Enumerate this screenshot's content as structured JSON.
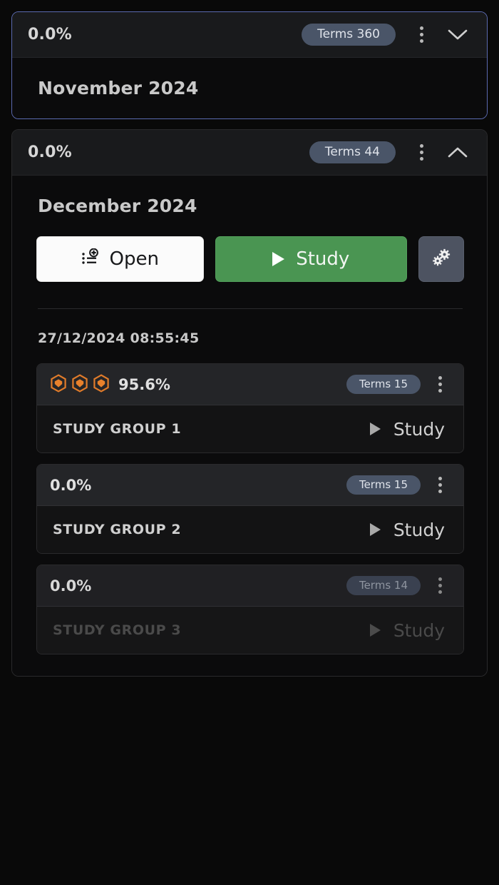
{
  "colors": {
    "accent_green": "#4a9552",
    "pill_blue": "#4a5568",
    "gem_orange": "#e07b2a",
    "focus_border": "#5b6ab0",
    "page_bg": "#090909"
  },
  "months": [
    {
      "percent": "0.0%",
      "terms_label": "Terms 360",
      "title": "November 2024",
      "expanded": false,
      "focused": true,
      "chevron_icon": "chevron-down-icon",
      "menu_icon": "kebab-menu-icon"
    },
    {
      "percent": "0.0%",
      "terms_label": "Terms 44",
      "title": "December 2024",
      "expanded": true,
      "focused": false,
      "chevron_icon": "chevron-up-icon",
      "menu_icon": "kebab-menu-icon",
      "actions": {
        "open_label": "Open",
        "open_icon": "list-add-icon",
        "study_label": "Study",
        "study_icon": "play-icon",
        "settings_icon": "gears-icon"
      },
      "timestamp": "27/12/2024 08:55:45",
      "groups": [
        {
          "percent": "95.6%",
          "gems": 3,
          "gem_icon": "hexagon-gem-icon",
          "terms_label": "Terms 15",
          "name": "STUDY GROUP 1",
          "study_label": "Study",
          "study_icon": "play-icon",
          "menu_icon": "kebab-menu-icon",
          "disabled": false
        },
        {
          "percent": "0.0%",
          "gems": 0,
          "gem_icon": "hexagon-gem-icon",
          "terms_label": "Terms 15",
          "name": "STUDY GROUP 2",
          "study_label": "Study",
          "study_icon": "play-icon",
          "menu_icon": "kebab-menu-icon",
          "disabled": false
        },
        {
          "percent": "0.0%",
          "gems": 0,
          "gem_icon": "hexagon-gem-icon",
          "terms_label": "Terms 14",
          "name": "STUDY GROUP 3",
          "study_label": "Study",
          "study_icon": "play-icon",
          "menu_icon": "kebab-menu-icon",
          "disabled": true
        }
      ]
    }
  ]
}
